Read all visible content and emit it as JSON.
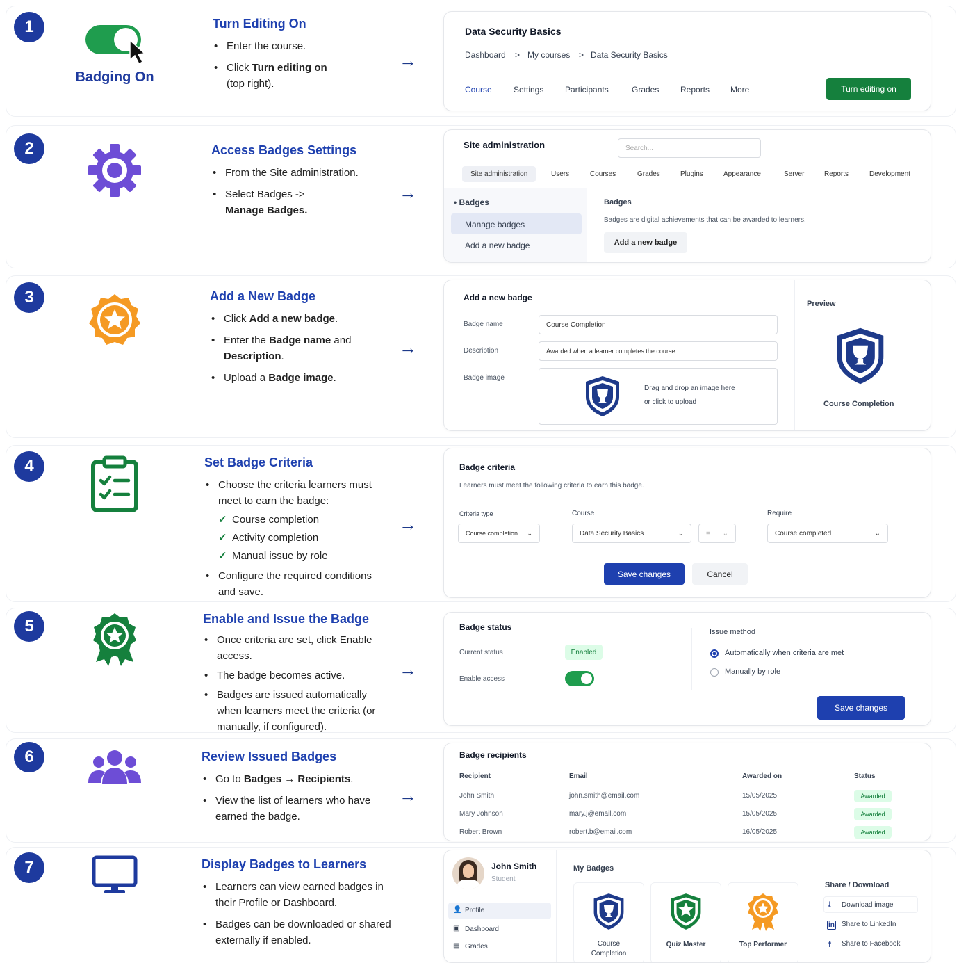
{
  "colors": {
    "brand_blue": "#1e3a9e",
    "link_blue": "#1e40af",
    "green": "#15803d",
    "purple": "#6d4dd6",
    "orange": "#f59a23"
  },
  "steps": [
    {
      "num": "1",
      "icon": "toggle-cursor-icon",
      "icon_label": "Badging On",
      "title": "Turn Editing On",
      "bullets": [
        "Enter the course.",
        "Click ",
        "Turn editing on",
        " (top right)."
      ]
    },
    {
      "num": "2",
      "icon": "gear-icon",
      "title": "Access Badges Settings",
      "b1": "From the Site administration.",
      "b2a": "Select Badges ->",
      "b2b": "Manage Badges."
    },
    {
      "num": "3",
      "icon": "star-badge-icon",
      "title": "Add a New Badge",
      "b1a": "Click ",
      "b1b": "Add a new badge",
      "b1c": ".",
      "b2a": "Enter the ",
      "b2b": "Badge name",
      "b2c": " and ",
      "b2d": "Description",
      "b2e": ".",
      "b3a": "Upload a ",
      "b3b": "Badge image",
      "b3c": "."
    },
    {
      "num": "4",
      "icon": "clipboard-check-icon",
      "title": "Set Badge Criteria",
      "b1": "Choose the criteria learners must meet to earn the badge:",
      "checks": [
        "Course completion",
        "Activity completion",
        "Manual issue by role"
      ],
      "b2": "Configure the required conditions and save."
    },
    {
      "num": "5",
      "icon": "award-ribbon-icon",
      "title": "Enable and Issue the Badge",
      "b1": "Once criteria are set, click Enable access.",
      "b2": "The badge becomes active.",
      "b3": "Badges are issued automatically when learners meet the criteria (or manually, if configured)."
    },
    {
      "num": "6",
      "icon": "users-icon",
      "title": "Review Issued Badges",
      "b1a": "Go to ",
      "b1b": "Badges → Recipients",
      "b1c": ".",
      "b2": "View the list of learners who have earned the badge."
    },
    {
      "num": "7",
      "icon": "monitor-icon",
      "title": "Display Badges to Learners",
      "b1": "Learners can view earned badges in their Profile or Dashboard.",
      "b2": "Badges can be downloaded or shared externally if enabled."
    }
  ],
  "arrow": "→",
  "panel1": {
    "title": "Data Security Basics",
    "crumbs": [
      "Dashboard",
      ">",
      "My courses",
      ">",
      "Data Security Basics"
    ],
    "tabs": [
      "Course",
      "Settings",
      "Participants",
      "Grades",
      "Reports",
      "More"
    ],
    "button": "Turn editing on"
  },
  "panel2": {
    "title": "Site administration",
    "search_placeholder": "Search...",
    "tabs": [
      "Site administration",
      "Users",
      "Courses",
      "Grades",
      "Plugins",
      "Appearance",
      "Server",
      "Reports",
      "Development"
    ],
    "side": [
      "Badges",
      "Manage badges",
      "Add a new badge"
    ],
    "heading": "Badges",
    "desc": "Badges are digital achievements that can be awarded to learners.",
    "button": "Add a new badge"
  },
  "panel3": {
    "title": "Add a new badge",
    "labels": [
      "Badge name",
      "Description",
      "Badge image"
    ],
    "name_value": "Course Completion",
    "desc_value": "Awarded when a learner completes the course.",
    "drop1": "Drag and drop an image here",
    "drop2": "or click to upload",
    "preview_label": "Preview",
    "preview_name": "Course Completion"
  },
  "panel4": {
    "title": "Badge criteria",
    "desc": "Learners must meet the following criteria to earn this badge.",
    "col1": "Criteria type",
    "col2": "Course",
    "col3": "Require",
    "v1": "Course completion",
    "v2": "Data Security Basics",
    "v_eq": "=",
    "v3": "Course completed",
    "save": "Save changes",
    "cancel": "Cancel"
  },
  "panel5": {
    "title": "Badge status",
    "current_label": "Current status",
    "current_value": "Enabled",
    "access_label": "Enable access",
    "access_on": true,
    "issue_title": "Issue method",
    "opt1": "Automatically when criteria are met",
    "opt2": "Manually by role",
    "save": "Save changes"
  },
  "panel6": {
    "title": "Badge recipients",
    "headers": [
      "Recipient",
      "Email",
      "Awarded on",
      "Status"
    ],
    "rows": [
      [
        "John Smith",
        "john.smith@email.com",
        "15/05/2025",
        "Awarded"
      ],
      [
        "Mary Johnson",
        "mary.j@email.com",
        "15/05/2025",
        "Awarded"
      ],
      [
        "Robert Brown",
        "robert.b@email.com",
        "16/05/2025",
        "Awarded"
      ]
    ]
  },
  "panel7": {
    "user": "John Smith",
    "role": "Student",
    "nav": [
      "Profile",
      "Dashboard",
      "Grades"
    ],
    "my_badges": "My Badges",
    "badges": [
      "Course Completion",
      "Quiz Master",
      "Top Performer"
    ],
    "share_title": "Share / Download",
    "share": [
      "Download image",
      "Share to LinkedIn",
      "Share to Facebook"
    ]
  }
}
